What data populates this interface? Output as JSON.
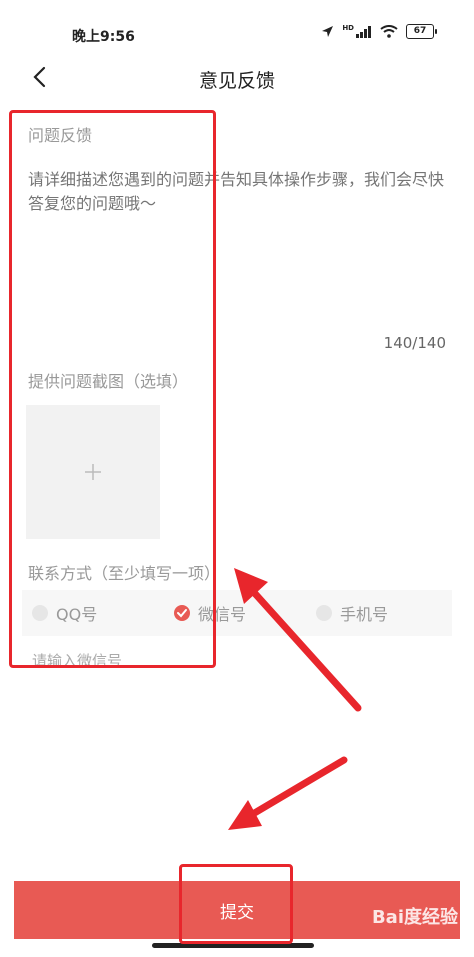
{
  "status_bar": {
    "time": "晚上9:56",
    "hd_label": "HD",
    "battery": "67"
  },
  "nav": {
    "title": "意见反馈",
    "back_icon": "chevron-left-icon"
  },
  "feedback": {
    "label": "问题反馈",
    "placeholder": "请详细描述您遇到的问题并告知具体操作步骤，我们会尽快答复您的问题哦～",
    "counter": "140/140"
  },
  "screenshot": {
    "label": "提供问题截图（选填）",
    "add_icon": "plus-icon"
  },
  "contact": {
    "label": "联系方式（至少填写一项）",
    "options": [
      {
        "label": "QQ号",
        "checked": false
      },
      {
        "label": "微信号",
        "checked": true
      },
      {
        "label": "手机号",
        "checked": false
      }
    ],
    "input_placeholder": "请输入微信号"
  },
  "submit": {
    "label": "提交"
  },
  "watermark": "Bai度经验",
  "colors": {
    "accent": "#e85a54",
    "annotation": "#e8262c"
  }
}
